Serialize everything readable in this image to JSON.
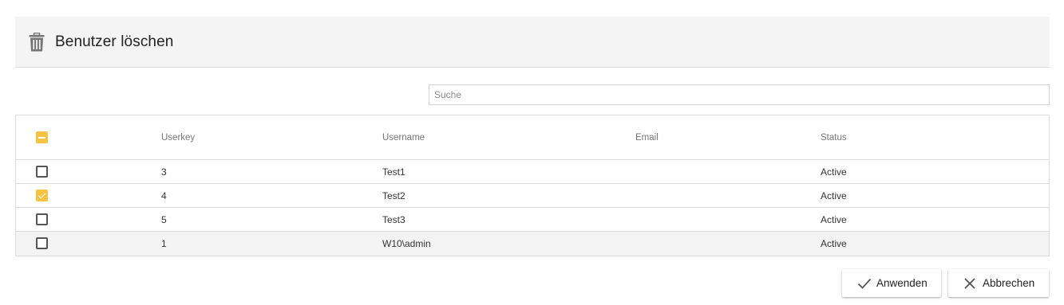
{
  "dialog": {
    "title": "Benutzer löschen",
    "icon": "trash-icon"
  },
  "search": {
    "placeholder": "Suche",
    "value": ""
  },
  "table": {
    "select_all_state": "partial",
    "columns": {
      "userkey": "Userkey",
      "username": "Username",
      "email": "Email",
      "status": "Status"
    },
    "rows": [
      {
        "checked": false,
        "userkey": "3",
        "username": "Test1",
        "email": "",
        "status": "Active"
      },
      {
        "checked": true,
        "userkey": "4",
        "username": "Test2",
        "email": "",
        "status": "Active"
      },
      {
        "checked": false,
        "userkey": "5",
        "username": "Test3",
        "email": "",
        "status": "Active"
      },
      {
        "checked": false,
        "userkey": "1",
        "username": "W10\\admin",
        "email": "",
        "status": "Active"
      }
    ]
  },
  "actions": {
    "apply_label": "Anwenden",
    "apply_icon": "check-icon",
    "cancel_label": "Abbrechen",
    "cancel_icon": "close-icon"
  },
  "colors": {
    "accent": "#f6c343",
    "header_bg": "#f4f4f4",
    "hover_row_bg": "#f3f3f3"
  }
}
